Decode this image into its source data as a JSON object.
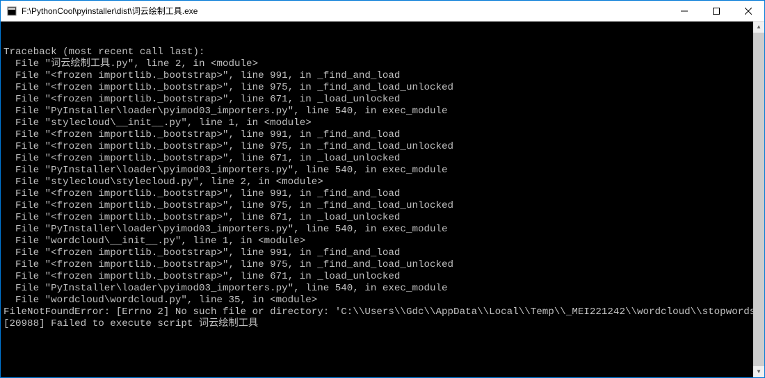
{
  "window": {
    "title": "F:\\PythonCool\\pyinstaller\\dist\\词云绘制工具.exe"
  },
  "console": {
    "lines": [
      "Traceback (most recent call last):",
      "  File \"词云绘制工具.py\", line 2, in <module>",
      "  File \"<frozen importlib._bootstrap>\", line 991, in _find_and_load",
      "  File \"<frozen importlib._bootstrap>\", line 975, in _find_and_load_unlocked",
      "  File \"<frozen importlib._bootstrap>\", line 671, in _load_unlocked",
      "  File \"PyInstaller\\loader\\pyimod03_importers.py\", line 540, in exec_module",
      "  File \"stylecloud\\__init__.py\", line 1, in <module>",
      "  File \"<frozen importlib._bootstrap>\", line 991, in _find_and_load",
      "  File \"<frozen importlib._bootstrap>\", line 975, in _find_and_load_unlocked",
      "  File \"<frozen importlib._bootstrap>\", line 671, in _load_unlocked",
      "  File \"PyInstaller\\loader\\pyimod03_importers.py\", line 540, in exec_module",
      "  File \"stylecloud\\stylecloud.py\", line 2, in <module>",
      "  File \"<frozen importlib._bootstrap>\", line 991, in _find_and_load",
      "  File \"<frozen importlib._bootstrap>\", line 975, in _find_and_load_unlocked",
      "  File \"<frozen importlib._bootstrap>\", line 671, in _load_unlocked",
      "  File \"PyInstaller\\loader\\pyimod03_importers.py\", line 540, in exec_module",
      "  File \"wordcloud\\__init__.py\", line 1, in <module>",
      "  File \"<frozen importlib._bootstrap>\", line 991, in _find_and_load",
      "  File \"<frozen importlib._bootstrap>\", line 975, in _find_and_load_unlocked",
      "  File \"<frozen importlib._bootstrap>\", line 671, in _load_unlocked",
      "  File \"PyInstaller\\loader\\pyimod03_importers.py\", line 540, in exec_module",
      "  File \"wordcloud\\wordcloud.py\", line 35, in <module>",
      "FileNotFoundError: [Errno 2] No such file or directory: 'C:\\\\Users\\\\Gdc\\\\AppData\\\\Local\\\\Temp\\\\_MEI221242\\\\wordcloud\\\\stopwords'",
      "[20988] Failed to execute script 词云绘制工具"
    ]
  }
}
